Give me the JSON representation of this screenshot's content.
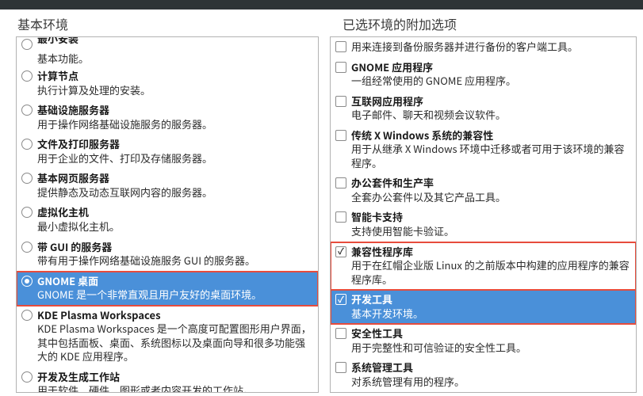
{
  "left": {
    "heading": "基本环境",
    "items": [
      {
        "title": "最小安装",
        "desc": "基本功能。",
        "selected": false,
        "highlight": false,
        "cut": true
      },
      {
        "title": "计算节点",
        "desc": "执行计算及处理的安装。",
        "selected": false,
        "highlight": false
      },
      {
        "title": "基础设施服务器",
        "desc": "用于操作网络基础设施服务的服务器。",
        "selected": false,
        "highlight": false
      },
      {
        "title": "文件及打印服务器",
        "desc": "用于企业的文件、打印及存储服务器。",
        "selected": false,
        "highlight": false
      },
      {
        "title": "基本网页服务器",
        "desc": "提供静态及动态互联网内容的服务器。",
        "selected": false,
        "highlight": false
      },
      {
        "title": "虚拟化主机",
        "desc": "最小虚拟化主机。",
        "selected": false,
        "highlight": false
      },
      {
        "title": "带 GUI 的服务器",
        "desc": "带有用于操作网络基础设施服务 GUI 的服务器。",
        "selected": false,
        "highlight": false
      },
      {
        "title": "GNOME 桌面",
        "desc": "GNOME 是一个非常直观且用户友好的桌面环境。",
        "selected": true,
        "highlight": true
      },
      {
        "title": "KDE Plasma Workspaces",
        "desc": "KDE Plasma Workspaces 是一个高度可配置图形用户界面，其中包括面板、桌面、系统图标以及桌面向导和很多功能强大的 KDE 应用程序。",
        "selected": false,
        "highlight": false
      },
      {
        "title": "开发及生成工作站",
        "desc": "用于软件、硬件、图形或者内容开发的工作站。",
        "selected": false,
        "highlight": false
      }
    ]
  },
  "right": {
    "heading": "已选环境的附加选项",
    "items": [
      {
        "title": "",
        "desc": "用来连接到备份服务器并进行备份的客户端工具。",
        "checked": false,
        "highlight": false,
        "notitle": true
      },
      {
        "title": "GNOME 应用程序",
        "desc": "一组经常使用的 GNOME 应用程序。",
        "checked": false,
        "highlight": false
      },
      {
        "title": "互联网应用程序",
        "desc": "电子邮件、聊天和视频会议软件。",
        "checked": false,
        "highlight": false
      },
      {
        "title": "传统 X Windows 系统的兼容性",
        "desc": "用于从继承 X Windows 环境中迁移或者可用于该环境的兼容程序。",
        "checked": false,
        "highlight": false
      },
      {
        "title": "办公套件和生产率",
        "desc": "全套办公套件以及其它产品工具。",
        "checked": false,
        "highlight": false
      },
      {
        "title": "智能卡支持",
        "desc": "支持使用智能卡验证。",
        "checked": false,
        "highlight": false
      },
      {
        "title": "兼容性程序库",
        "desc": "用于在红帽企业版 Linux 的之前版本中构建的应用程序的兼容程序库。",
        "checked": true,
        "highlight": true
      },
      {
        "title": "开发工具",
        "desc": "基本开发环境。",
        "checked": true,
        "highlight": true,
        "selected": true
      },
      {
        "title": "安全性工具",
        "desc": "用于完整性和可信验证的安全性工具。",
        "checked": false,
        "highlight": false
      },
      {
        "title": "系统管理工具",
        "desc": "对系统管理有用的程序。",
        "checked": false,
        "highlight": false
      }
    ]
  }
}
